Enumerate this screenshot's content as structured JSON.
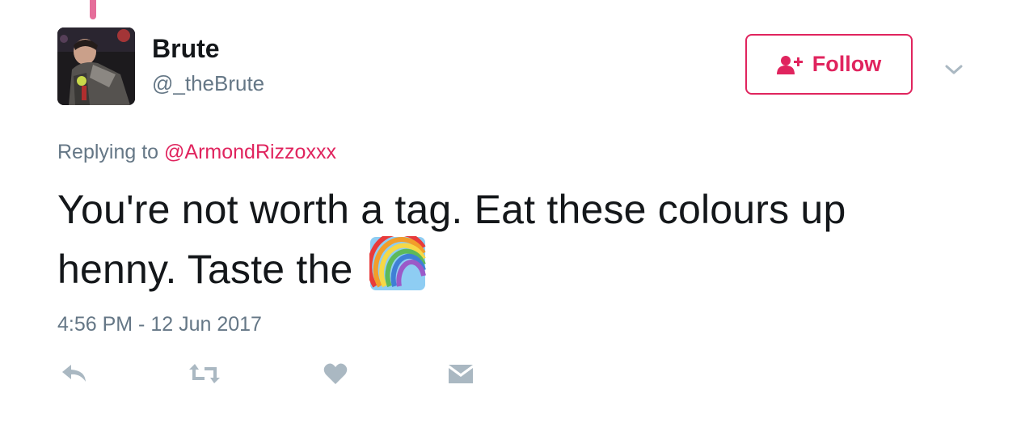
{
  "tweet": {
    "author": {
      "display_name": "Brute",
      "screen_name": "@_theBrute",
      "avatar": "profile-photo"
    },
    "follow_button": {
      "label": "Follow",
      "icon": "add-user-icon",
      "color": "#e0245e"
    },
    "menu_icon": "chevron-down-icon",
    "reply_context": {
      "prefix": "Replying to",
      "mention": "@ArmondRizzoxxx"
    },
    "text": "You're not worth a tag. Eat these colours up henny. Taste the",
    "emoji": "rainbow",
    "timestamp": "4:56 PM - 12 Jun 2017",
    "actions": [
      {
        "name": "reply",
        "icon": "reply-icon"
      },
      {
        "name": "retweet",
        "icon": "retweet-icon"
      },
      {
        "name": "like",
        "icon": "heart-icon"
      },
      {
        "name": "direct-message",
        "icon": "envelope-icon"
      }
    ],
    "colors": {
      "accent": "#e0245e",
      "secondary_text": "#657786",
      "primary_text": "#14171a",
      "action_icon": "#aab8c2",
      "thread_line": "#e56e9a"
    }
  }
}
